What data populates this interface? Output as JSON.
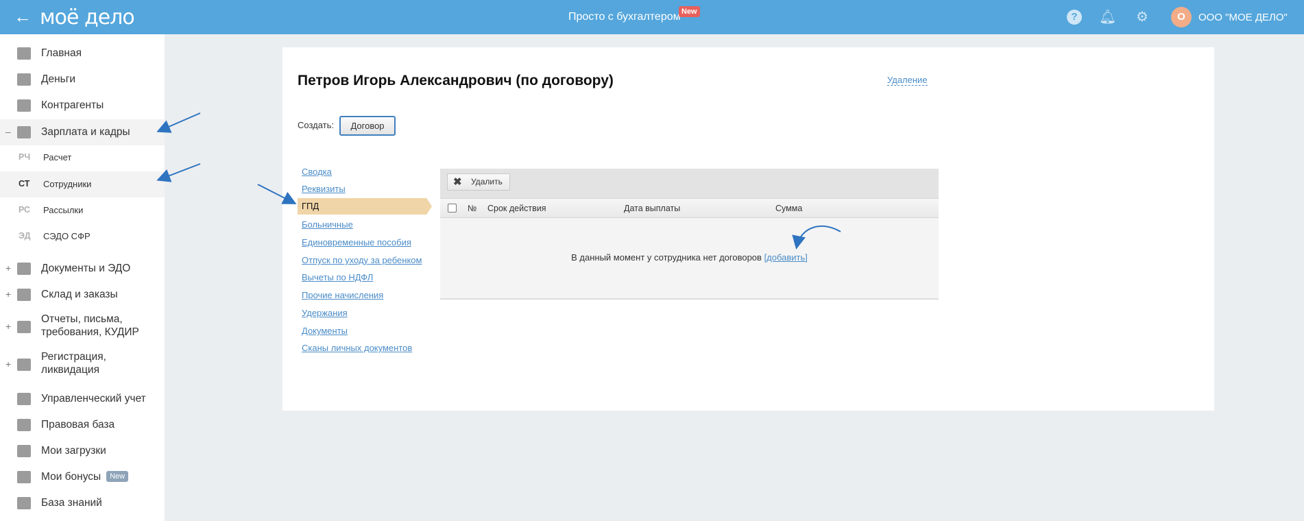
{
  "header": {
    "logo": "моё дело",
    "promo": "Просто с бухгалтером",
    "promo_badge": "New",
    "avatar_letter": "О",
    "org": "ООО \"МОЕ ДЕЛО\""
  },
  "sidebar": {
    "items": [
      {
        "label": "Главная"
      },
      {
        "label": "Деньги"
      },
      {
        "label": "Контрагенты"
      },
      {
        "label": "Зарплата и кадры",
        "toggle": "–"
      },
      {
        "label": "Документы и ЭДО",
        "toggle": "+"
      },
      {
        "label": "Склад и заказы",
        "toggle": "+"
      },
      {
        "label": "Отчеты, письма, требования, КУДИР",
        "toggle": "+"
      },
      {
        "label": "Регистрация, ликвидация",
        "toggle": "+"
      },
      {
        "label": "Управленческий учет"
      },
      {
        "label": "Правовая база"
      },
      {
        "label": "Мои загрузки"
      },
      {
        "label": "Мои бонусы",
        "badge": "New"
      },
      {
        "label": "База знаний"
      }
    ],
    "subitems": [
      {
        "abbr": "РЧ",
        "label": "Расчет"
      },
      {
        "abbr": "СТ",
        "label": "Сотрудники"
      },
      {
        "abbr": "РС",
        "label": "Рассылки"
      },
      {
        "abbr": "ЭД",
        "label": "СЭДО СФР"
      }
    ]
  },
  "main": {
    "title": "Петров Игорь Александрович (по договору)",
    "delete_link": "Удаление",
    "create_label": "Создать:",
    "create_button": "Договор",
    "nav": [
      "Сводка",
      "Реквизиты",
      "ГПД",
      "Больничные",
      "Единовременные пособия",
      "Отпуск по уходу за ребенком",
      "Вычеты по НДФЛ",
      "Прочие начисления",
      "Удержания",
      "Документы",
      "Сканы личных документов"
    ],
    "table": {
      "delete_button": "Удалить",
      "columns": [
        "№",
        "Срок действия",
        "Дата выплаты",
        "Сумма"
      ],
      "empty_text": "В данный момент у сотрудника нет договоров",
      "add_link": "[добавить]"
    }
  },
  "colors": {
    "header": "#54a6dc",
    "accent": "#4a8cc8",
    "selected_tab": "#f0d5a8",
    "annotation": "#2f74c0"
  }
}
